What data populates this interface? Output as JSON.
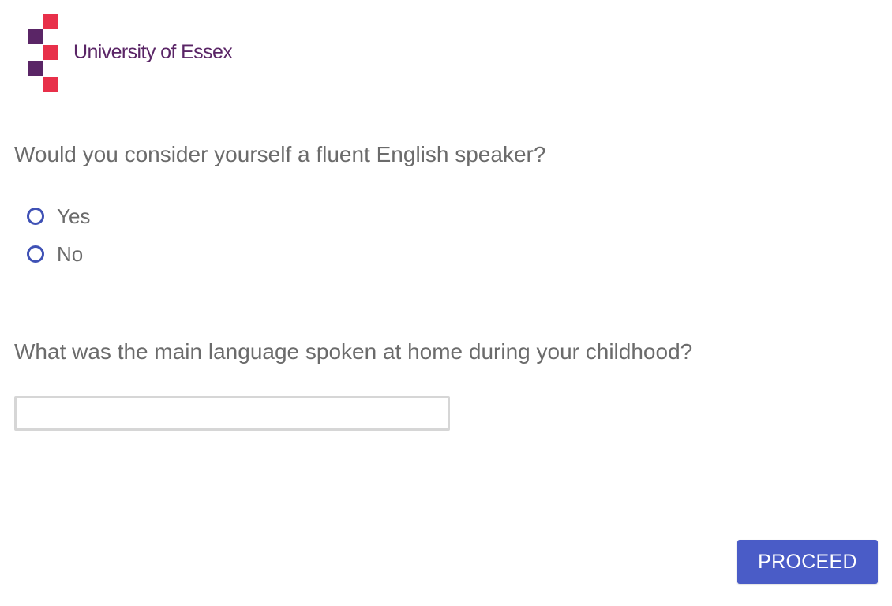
{
  "header": {
    "logo_text": "University of Essex",
    "logo_colors": {
      "purple": "#5a2566",
      "red": "#e8304a",
      "text": "#5a2566"
    }
  },
  "questions": [
    {
      "text": "Would you consider yourself a fluent English speaker?",
      "type": "radio",
      "options": [
        "Yes",
        "No"
      ],
      "selected": null
    },
    {
      "text": "What was the main language spoken at home during your childhood?",
      "type": "text",
      "value": "",
      "placeholder": ""
    }
  ],
  "footer": {
    "proceed_label": "PROCEED"
  },
  "colors": {
    "accent": "#3f51b5",
    "button": "#4a5cc7",
    "text": "#6b6b6b",
    "divider": "#e3e3e3",
    "input_border": "#d6d6d6"
  }
}
